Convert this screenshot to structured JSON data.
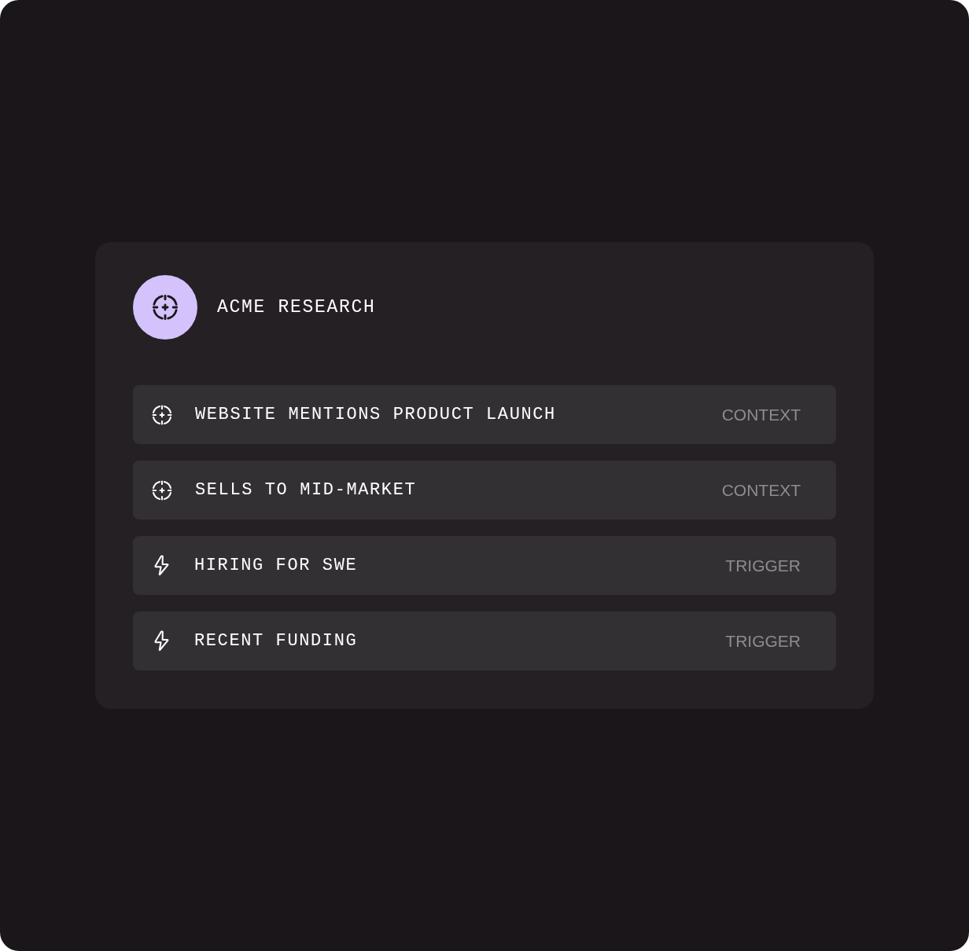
{
  "header": {
    "title": "ACME RESEARCH"
  },
  "signals": [
    {
      "kind": "context",
      "label": "WEBSITE MENTIONS PRODUCT LAUNCH",
      "tag": "CONTEXT"
    },
    {
      "kind": "context",
      "label": "SELLS TO MID-MARKET",
      "tag": "CONTEXT"
    },
    {
      "kind": "trigger",
      "label": "HIRING FOR SWE",
      "tag": "TRIGGER"
    },
    {
      "kind": "trigger",
      "label": "RECENT FUNDING",
      "tag": "TRIGGER"
    }
  ]
}
